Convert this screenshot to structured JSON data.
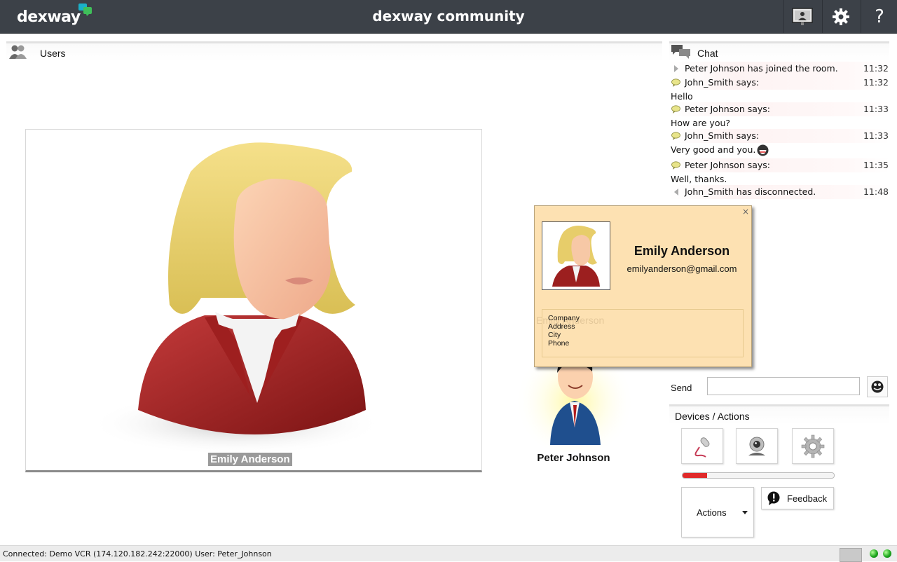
{
  "app": {
    "logo": "dexway",
    "title": "dexway community"
  },
  "toolbar": [
    {
      "name": "presentation-icon"
    },
    {
      "name": "gear-icon"
    },
    {
      "name": "help-icon",
      "glyph": "?"
    }
  ],
  "users_panel": {
    "title": "Users",
    "main_video": {
      "user_name": "Emily Anderson"
    },
    "thumbnail": {
      "user_name": "Peter Johnson"
    }
  },
  "profile_popup": {
    "close": "×",
    "name": "Emily Anderson",
    "email": "emilyanderson@gmail.com",
    "fields": [
      "Company",
      "Address",
      "City",
      "Phone"
    ],
    "ghost_text": "Emily Anderson"
  },
  "chat": {
    "title": "Chat",
    "messages": [
      {
        "kind": "join",
        "text": "Peter Johnson has joined the room.",
        "time": "11:32"
      },
      {
        "kind": "says",
        "text": "John_Smith says:",
        "time": "11:32"
      },
      {
        "kind": "msg",
        "text": "Hello"
      },
      {
        "kind": "says",
        "text": "Peter Johnson says:",
        "time": "11:33"
      },
      {
        "kind": "msg",
        "text": "How are you?"
      },
      {
        "kind": "says",
        "text": "John_Smith says:",
        "time": "11:33"
      },
      {
        "kind": "msg",
        "text": "Very good and you.",
        "emoji": "grin-emoji-icon"
      },
      {
        "kind": "says",
        "text": "Peter Johnson says:",
        "time": "11:35"
      },
      {
        "kind": "msg",
        "text": "Well, thanks."
      },
      {
        "kind": "leave",
        "text": "John_Smith has disconnected.",
        "time": "11:48"
      }
    ],
    "send_label": "Send",
    "input_value": ""
  },
  "devices": {
    "title": "Devices / Actions",
    "buttons": [
      {
        "name": "microphone-icon"
      },
      {
        "name": "webcam-icon"
      },
      {
        "name": "settings-gear-icon"
      }
    ],
    "mic_level": 0.16,
    "actions_label": "Actions",
    "feedback_label": "Feedback"
  },
  "status": {
    "text": "Connected: Demo VCR (174.120.182.242:22000) User: Peter_Johnson",
    "indicators": [
      "green",
      "green"
    ]
  },
  "colors": {
    "topbar": "#3c4148",
    "popup_bg": "#fde1b2",
    "level": "#e02a2a",
    "led": "#1fa81f"
  }
}
